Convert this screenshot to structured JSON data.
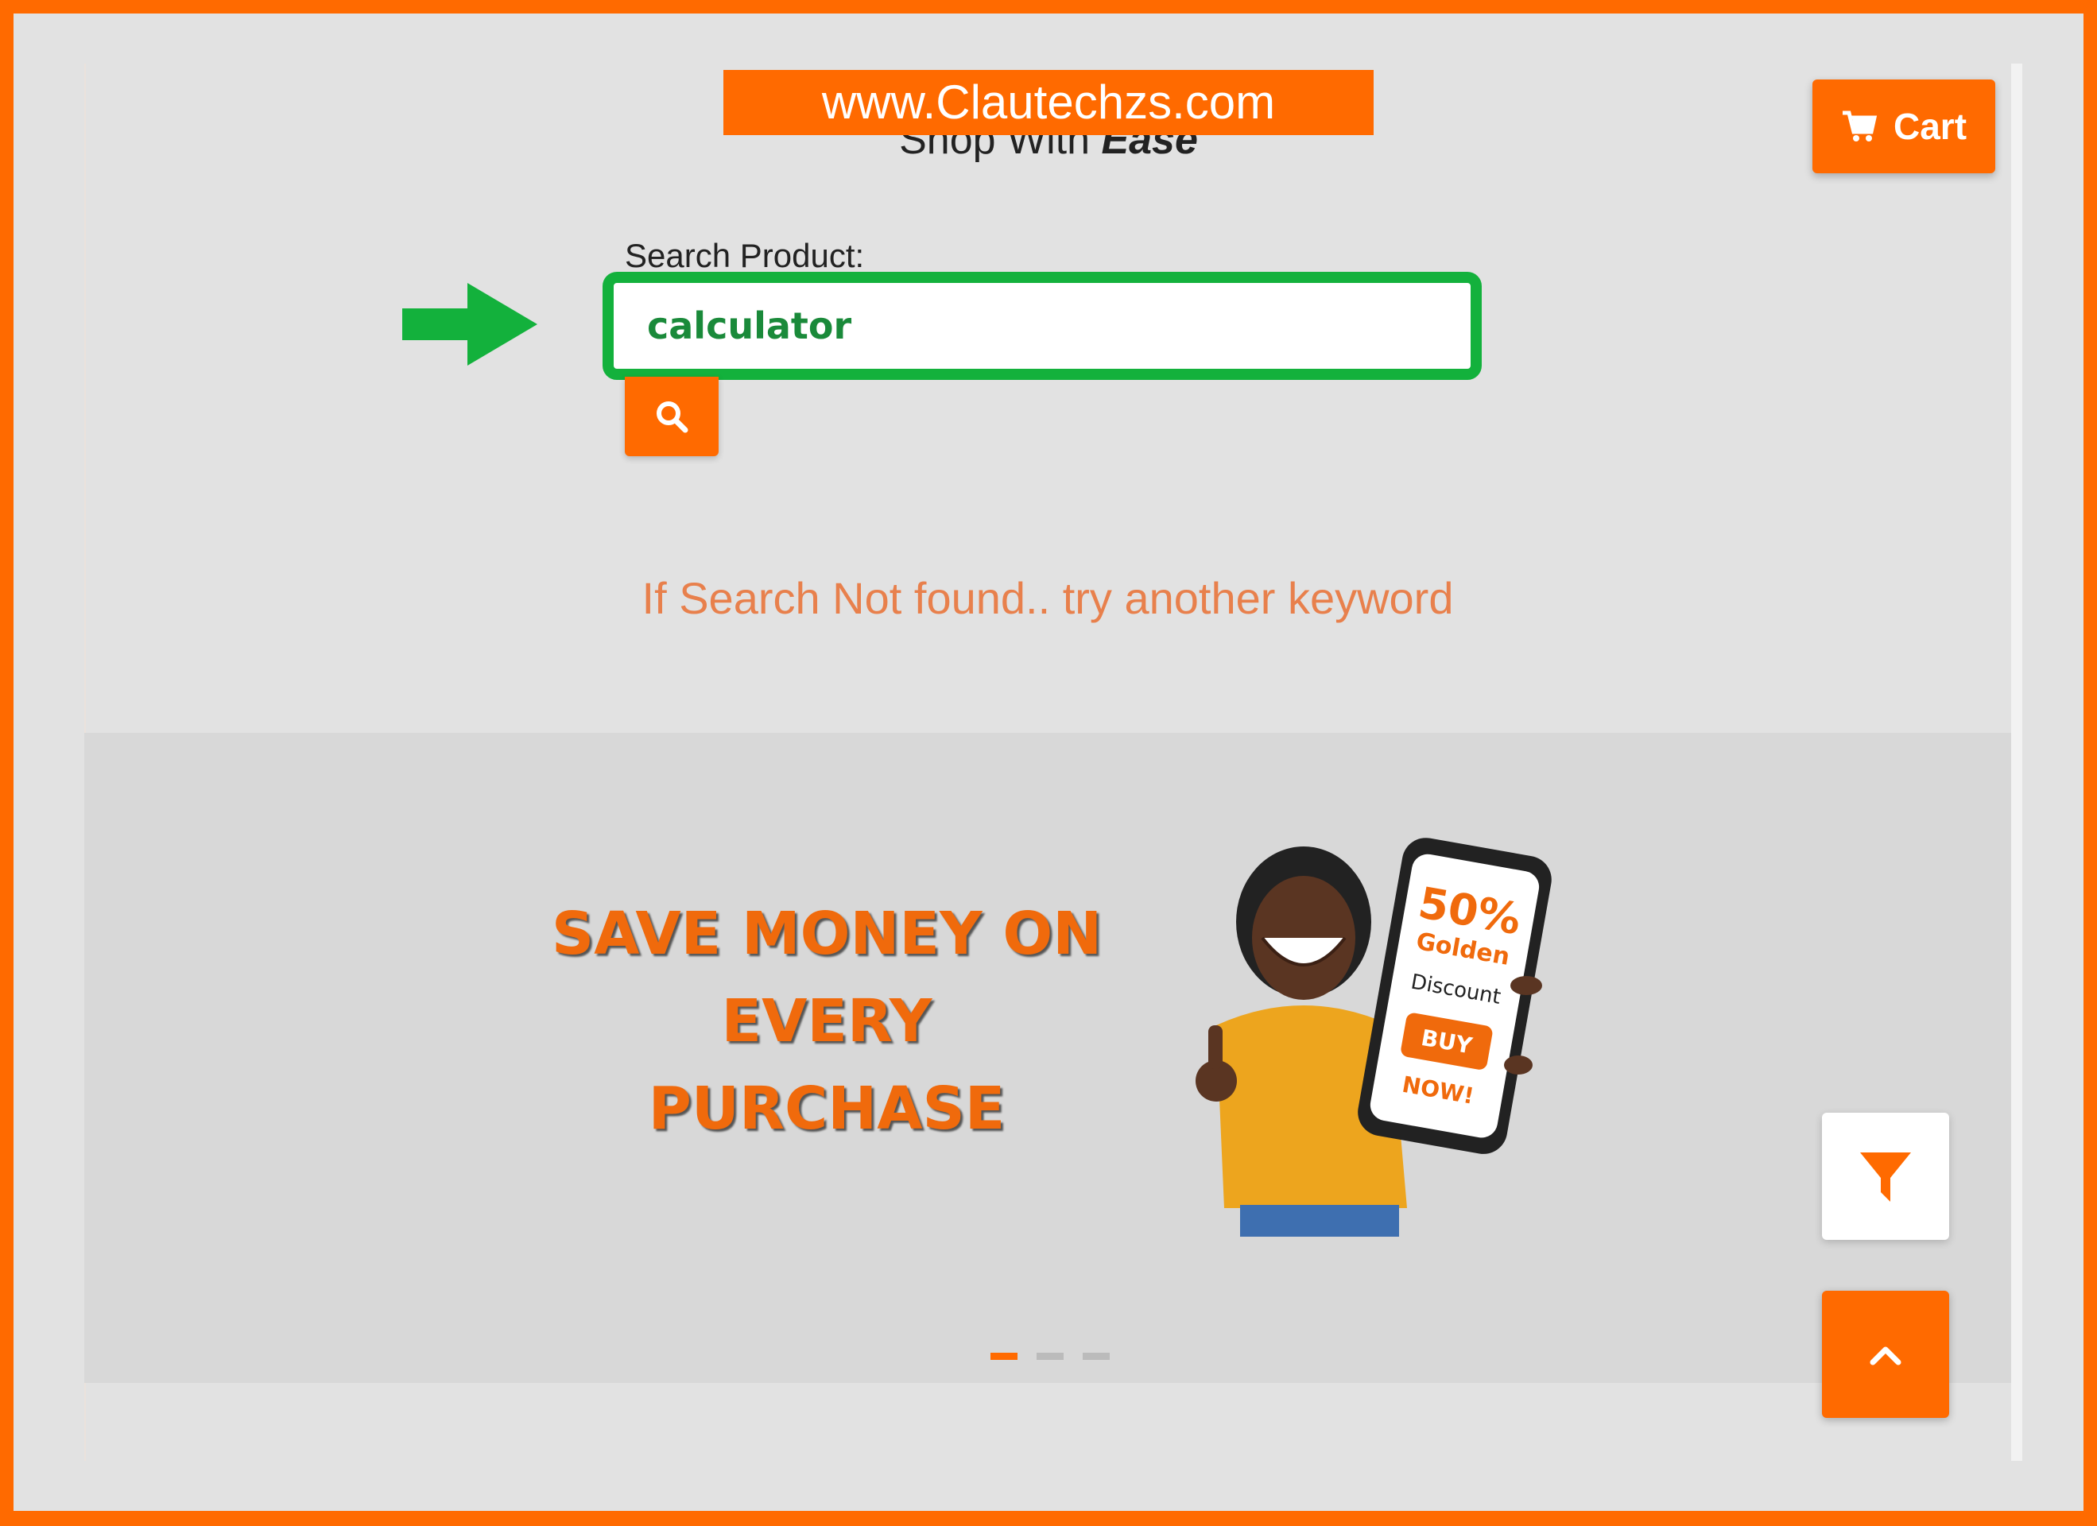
{
  "header": {
    "watermark": "www.Clautechzs.com",
    "title_prefix": "Shop With",
    "title_emphasis": "Ease",
    "cart_label": "Cart"
  },
  "search": {
    "label": "Search Product:",
    "value": "calculator",
    "placeholder": ""
  },
  "notice": "If Search Not found.. try another keyword",
  "promo": {
    "line1": "SAVE MONEY ON",
    "line2": "EVERY",
    "line3": "PURCHASE",
    "phone_percent": "50%",
    "phone_golden": "Golden",
    "phone_discount": "Discount",
    "phone_buy": "BUY",
    "phone_now": "NOW!"
  },
  "carousel": {
    "slides": 3,
    "active_index": 0
  },
  "colors": {
    "brand": "#ff6a00",
    "highlight": "#13b13c"
  },
  "icons": {
    "cart": "cart-icon",
    "search": "search-icon",
    "filter": "filter-icon",
    "top": "chevron-up-icon",
    "arrow": "arrow-right-icon"
  }
}
